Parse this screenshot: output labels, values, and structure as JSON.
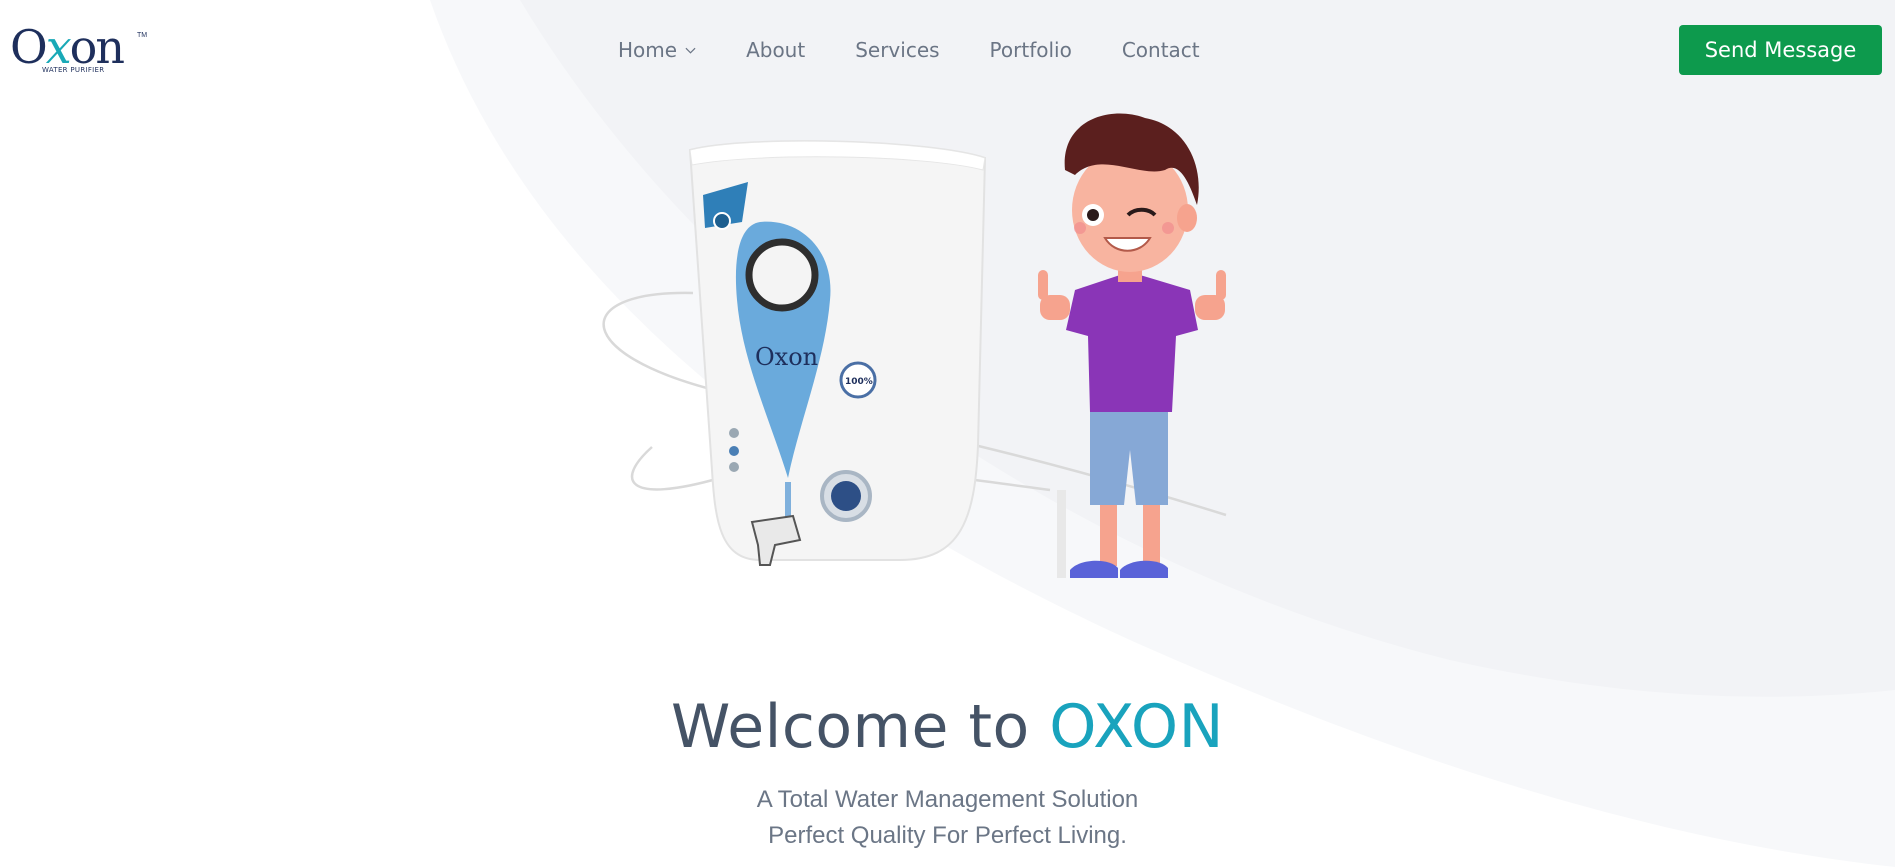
{
  "brand": {
    "logo_word_o": "O",
    "logo_word_x": "x",
    "logo_word_rest": "on",
    "logo_sub": "WATER    PURIFIER",
    "logo_tm": "TM",
    "accent": "#19a3bd",
    "navy": "#1e2f5c"
  },
  "nav": {
    "items": [
      {
        "label": "Home",
        "has_dropdown": true
      },
      {
        "label": "About"
      },
      {
        "label": "Services"
      },
      {
        "label": "Portfolio"
      },
      {
        "label": "Contact"
      }
    ]
  },
  "header": {
    "cta_label": "Send Message",
    "cta_color": "#0d9a4d"
  },
  "hero": {
    "illustration": "water-purifier-and-boy-illustration",
    "product_brand_text": "Oxon",
    "badge_text": "100%",
    "title_prefix": "Welcome to ",
    "title_brand": "OXON",
    "tagline_line1": "A Total Water Management Solution",
    "tagline_line2": "Perfect Quality For Perfect Living."
  }
}
